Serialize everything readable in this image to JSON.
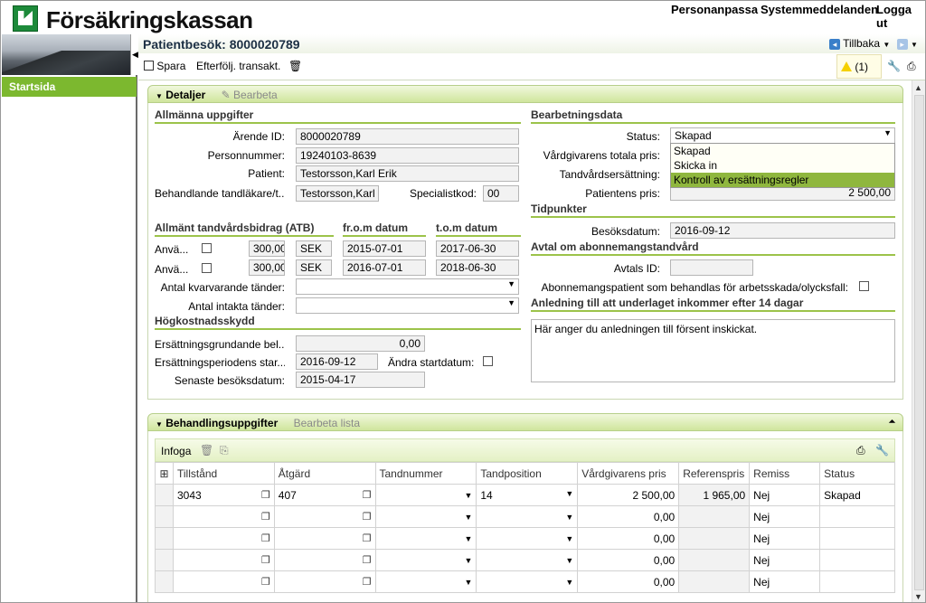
{
  "app": {
    "title": "Försäkringskassan"
  },
  "top_links": [
    "Personanpassa",
    "Systemmeddelanden",
    "Logga ut"
  ],
  "sidebar": {
    "items": [
      "Startsida"
    ]
  },
  "page": {
    "title": "Patientbesök: 8000020789",
    "back_label": "Tillbaka"
  },
  "toolbar": {
    "save_label": "Spara",
    "followup_label": "Efterfölj. transakt.",
    "notification_count": "(1)"
  },
  "details": {
    "panel_title": "Detaljer",
    "edit_label": "Bearbeta",
    "general": {
      "heading": "Allmänna uppgifter",
      "arende_label": "Ärende ID:",
      "arende_value": "8000020789",
      "personnummer_label": "Personnummer:",
      "personnummer_value": "19240103-8639",
      "patient_label": "Patient:",
      "patient_value": "Testorsson,Karl Erik",
      "tandlakare_label": "Behandlande tandläkare/t...",
      "tandlakare_value": "Testorsson,Karl E",
      "specialist_label": "Specialistkod:",
      "specialist_value": "00"
    },
    "atb": {
      "heading": "Allmänt tandvårdsbidrag (ATB)",
      "from_label": "fr.o.m datum",
      "tom_label": "t.o.m datum",
      "rows": [
        {
          "label": "Anvä...",
          "amount": "300,00",
          "currency": "SEK",
          "from": "2015-07-01",
          "tom": "2017-06-30"
        },
        {
          "label": "Anvä...",
          "amount": "300,00",
          "currency": "SEK",
          "from": "2016-07-01",
          "tom": "2018-06-30"
        }
      ],
      "kvarvarande_label": "Antal kvarvarande tänder:",
      "intakta_label": "Antal intakta tänder:"
    },
    "hogkostnad": {
      "heading": "Högkostnadsskydd",
      "grund_label": "Ersättningsgrundande bel...",
      "grund_value": "0,00",
      "period_label": "Ersättningsperiodens star...",
      "period_value": "2016-09-12",
      "andra_label": "Ändra startdatum:",
      "senaste_label": "Senaste besöksdatum:",
      "senaste_value": "2015-04-17"
    },
    "bearbetning": {
      "heading": "Bearbetningsdata",
      "status_label": "Status:",
      "status_value": "Skapad",
      "status_options": [
        "Skapad",
        "Skicka in",
        "Kontroll av ersättningsregler"
      ],
      "totala_label": "Vårdgivarens totala pris:",
      "ersattning_label": "Tandvårdsersättning:",
      "patientpris_label": "Patientens pris:",
      "patientpris_value": "2 500,00"
    },
    "tidpunkter": {
      "heading": "Tidpunkter",
      "besok_label": "Besöksdatum:",
      "besok_value": "2016-09-12"
    },
    "abonnemang": {
      "heading": "Avtal om abonnemangstandvård",
      "avtal_label": "Avtals ID:",
      "arbetsskada_label": "Abonnemangspatient som behandlas för arbetsskada/olycksfall:"
    },
    "anledning": {
      "heading": "Anledning till att underlaget inkommer efter 14 dagar",
      "text": "Här anger du anledningen till försent inskickat."
    }
  },
  "behandling": {
    "panel_title": "Behandlingsuppgifter",
    "edit_list_label": "Bearbeta lista",
    "infoga_label": "Infoga",
    "columns": [
      "Tillstånd",
      "Åtgärd",
      "Tandnummer",
      "Tandposition",
      "Vårdgivarens pris",
      "Referenspris",
      "Remiss",
      "Status"
    ],
    "rows": [
      {
        "tillstand": "3043",
        "atgard": "407",
        "tandnummer": "",
        "tandposition": "14",
        "pris": "2 500,00",
        "referens": "1 965,00",
        "remiss": "Nej",
        "status": "Skapad"
      },
      {
        "tillstand": "",
        "atgard": "",
        "tandnummer": "",
        "tandposition": "",
        "pris": "0,00",
        "referens": "",
        "remiss": "Nej",
        "status": ""
      },
      {
        "tillstand": "",
        "atgard": "",
        "tandnummer": "",
        "tandposition": "",
        "pris": "0,00",
        "referens": "",
        "remiss": "Nej",
        "status": ""
      },
      {
        "tillstand": "",
        "atgard": "",
        "tandnummer": "",
        "tandposition": "",
        "pris": "0,00",
        "referens": "",
        "remiss": "Nej",
        "status": ""
      },
      {
        "tillstand": "",
        "atgard": "",
        "tandnummer": "",
        "tandposition": "",
        "pris": "0,00",
        "referens": "",
        "remiss": "Nej",
        "status": ""
      }
    ]
  }
}
